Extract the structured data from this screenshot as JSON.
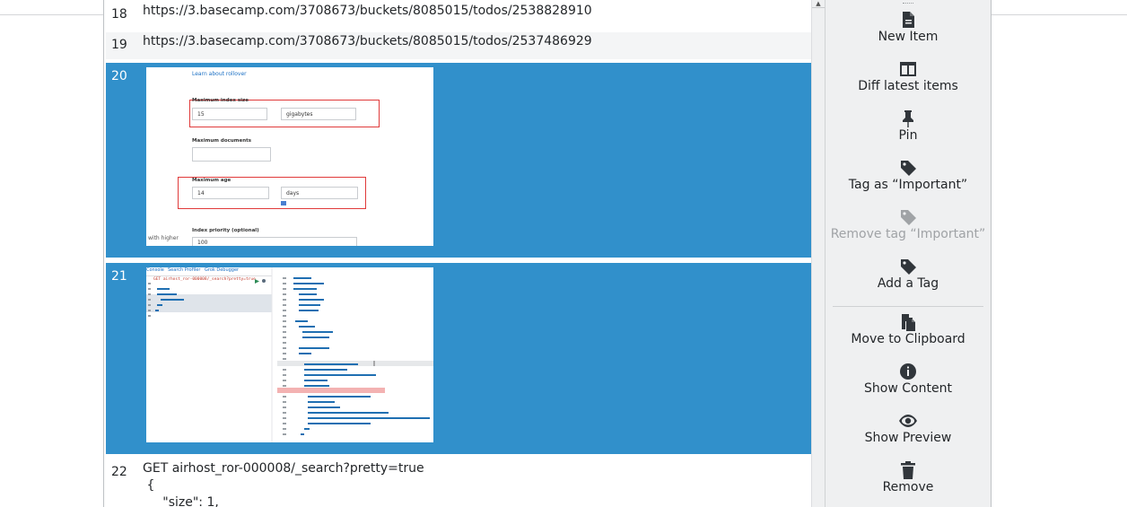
{
  "rows": [
    {
      "num": "18",
      "text": "https://3.basecamp.com/3708673/buckets/8085015/todos/2538828910"
    },
    {
      "num": "19",
      "text": "https://3.basecamp.com/3708673/buckets/8085015/todos/2537486929"
    },
    {
      "num": "20",
      "text": ""
    },
    {
      "num": "21",
      "text": ""
    },
    {
      "num": "22",
      "text": "GET airhost_ror-000008/_search?pretty=true",
      "line2": " {",
      "line3": "     \"size\": 1,"
    }
  ],
  "thumb20": {
    "learn": "Learn about rollover",
    "max_index_size_label": "Maximum index size",
    "max_index_size_value": "15",
    "max_index_size_unit": "gigabytes",
    "max_docs_label": "Maximum documents",
    "max_age_label": "Maximum age",
    "max_age_value": "14",
    "max_age_unit": "days",
    "side_note": "with higher",
    "priority_label": "Index priority (optional)",
    "priority_value": "100"
  },
  "thumb21": {
    "tabs": [
      "Console",
      "Search Profiler",
      "Grok Debugger"
    ],
    "request_line": "GET airhost_ror-000008/_search?pretty=true"
  },
  "actions": [
    {
      "label": "New Item",
      "icon": "new-item-icon",
      "disabled": false
    },
    {
      "label": "Diff latest items",
      "icon": "diff-icon",
      "disabled": false
    },
    {
      "label": "Pin",
      "icon": "pin-icon",
      "disabled": false
    },
    {
      "label": "Tag as “Important”",
      "icon": "tag-icon",
      "disabled": false
    },
    {
      "label": "Remove tag “Important”",
      "icon": "tag-icon",
      "disabled": true
    },
    {
      "label": "Add a Tag",
      "icon": "tag-icon",
      "disabled": false
    },
    {
      "label": "Move to Clipboard",
      "icon": "clipboard-icon",
      "disabled": false
    },
    {
      "label": "Show Content",
      "icon": "info-icon",
      "disabled": false
    },
    {
      "label": "Show Preview",
      "icon": "eye-icon",
      "disabled": false
    },
    {
      "label": "Remove",
      "icon": "trash-icon",
      "disabled": false
    }
  ],
  "colors": {
    "selection": "#3190cb",
    "sidebar": "#eff0f1",
    "text": "#232629"
  }
}
